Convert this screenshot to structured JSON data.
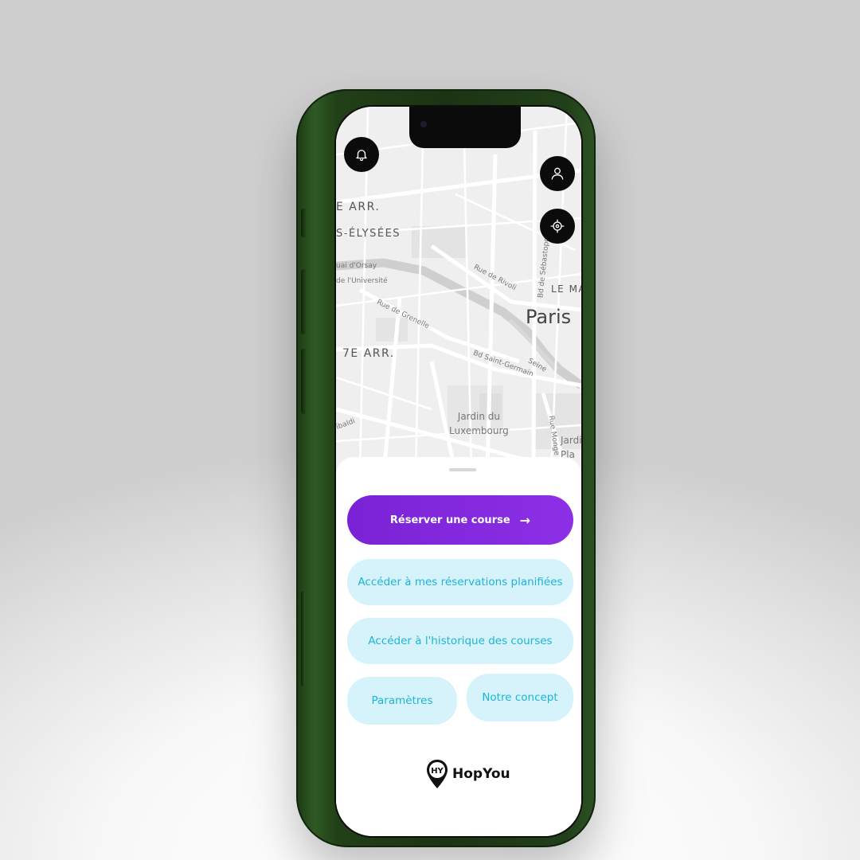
{
  "map": {
    "labels": {
      "arr8": "E ARR.",
      "champs": "S-ÉLYSÉES",
      "quai_orsay": "uai d'Orsay",
      "universite": "de l'Université",
      "rivoli": "Rue de Rivoli",
      "sebastopol": "Bd de Sébastopol",
      "marais": "LE MA",
      "paris": "Paris",
      "grenelle": "Rue de Grenelle",
      "arr7": "7E ARR.",
      "st_germain": "Bd Saint-Germain",
      "seine": "Seine",
      "lux_line1": "Jardin du",
      "lux_line2": "Luxembourg",
      "monge": "Rue Monge",
      "plantes_line1": "Jardi",
      "plantes_line2": "Pla",
      "garibaldi": "ibaldi"
    }
  },
  "icons": {
    "notifications": "bell-icon",
    "profile": "user-icon",
    "locate": "target-icon",
    "arrow": "arrow-right-icon",
    "logo": "map-pin-hy-icon"
  },
  "actions": {
    "book": "Réserver une course",
    "planned": "Accéder à mes réservations planifiées",
    "history": "Accéder à l'historique des courses",
    "settings": "Paramètres",
    "concept": "Notre concept"
  },
  "brand": {
    "logo_mark": "HY",
    "name": "HopYou"
  },
  "colors": {
    "primary": "#8328de",
    "secondary_bg": "#d6f3fc",
    "secondary_text": "#1cb4d8",
    "phone_frame": "#1f3b16"
  }
}
